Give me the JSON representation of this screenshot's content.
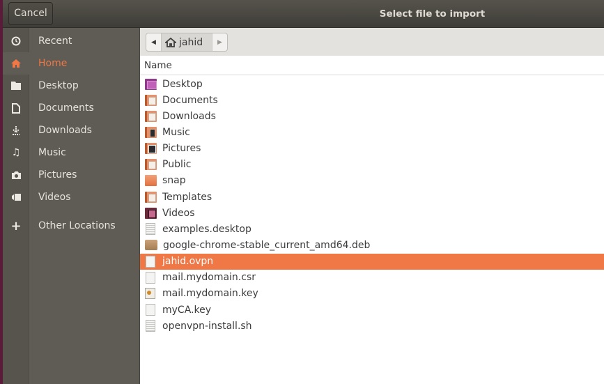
{
  "dialog": {
    "title": "Select file to import",
    "cancel_label": "Cancel"
  },
  "sidebar": {
    "items": [
      {
        "label": "Recent",
        "icon": "clock-icon",
        "active": false
      },
      {
        "label": "Home",
        "icon": "home-icon",
        "active": true
      },
      {
        "label": "Desktop",
        "icon": "desktop-folder-icon",
        "active": false
      },
      {
        "label": "Documents",
        "icon": "document-icon",
        "active": false
      },
      {
        "label": "Downloads",
        "icon": "download-icon",
        "active": false
      },
      {
        "label": "Music",
        "icon": "music-icon",
        "active": false
      },
      {
        "label": "Pictures",
        "icon": "camera-icon",
        "active": false
      },
      {
        "label": "Videos",
        "icon": "video-icon",
        "active": false
      },
      {
        "label": "Other Locations",
        "icon": "plus-icon",
        "active": false
      }
    ]
  },
  "pathbar": {
    "current": "jahid",
    "icon": "home-icon"
  },
  "file_list": {
    "column_header": "Name",
    "selected_color": "#f07746",
    "files": [
      {
        "name": "Desktop",
        "type": "folder-desktop"
      },
      {
        "name": "Documents",
        "type": "folder-documents"
      },
      {
        "name": "Downloads",
        "type": "folder-downloads"
      },
      {
        "name": "Music",
        "type": "folder-music"
      },
      {
        "name": "Pictures",
        "type": "folder-pictures"
      },
      {
        "name": "Public",
        "type": "folder-public"
      },
      {
        "name": "snap",
        "type": "folder"
      },
      {
        "name": "Templates",
        "type": "folder-templates"
      },
      {
        "name": "Videos",
        "type": "folder-videos"
      },
      {
        "name": "examples.desktop",
        "type": "text-file"
      },
      {
        "name": "google-chrome-stable_current_amd64.deb",
        "type": "package"
      },
      {
        "name": "jahid.ovpn",
        "type": "file",
        "selected": true
      },
      {
        "name": "mail.mydomain.csr",
        "type": "file"
      },
      {
        "name": "mail.mydomain.key",
        "type": "certificate"
      },
      {
        "name": "myCA.key",
        "type": "file"
      },
      {
        "name": "openvpn-install.sh",
        "type": "text-file"
      }
    ]
  }
}
